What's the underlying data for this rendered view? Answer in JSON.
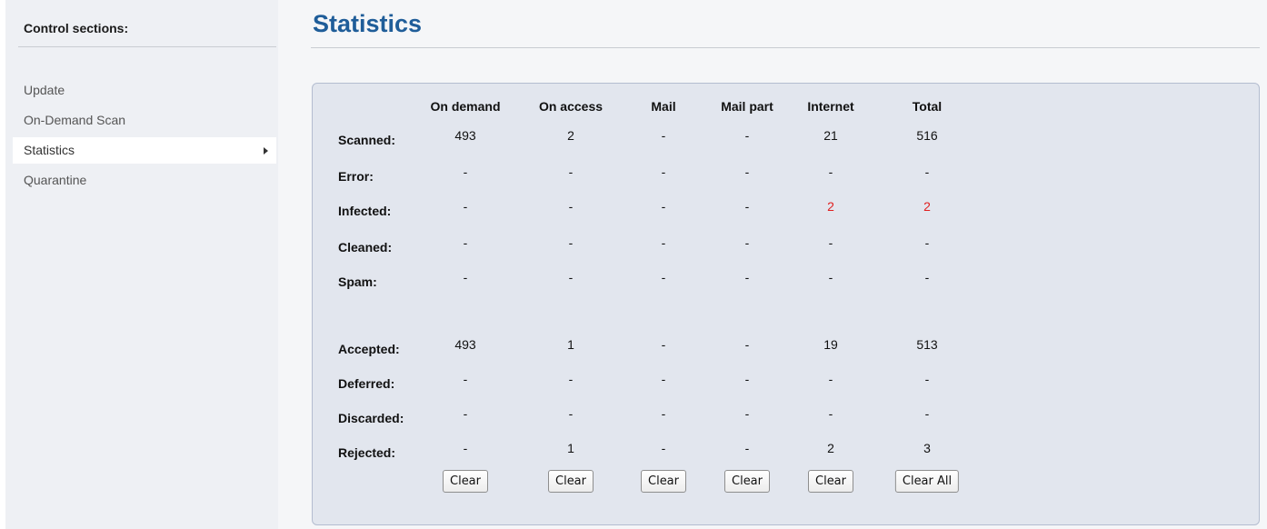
{
  "sidebar": {
    "title": "Control sections:",
    "items": [
      {
        "label": "Update"
      },
      {
        "label": "On-Demand Scan"
      },
      {
        "label": "Statistics",
        "active": true
      },
      {
        "label": "Quarantine"
      }
    ]
  },
  "main": {
    "title": "Statistics"
  },
  "stats": {
    "columns": [
      "On demand",
      "On access",
      "Mail",
      "Mail part",
      "Internet",
      "Total"
    ],
    "rows": [
      {
        "label": "Scanned:",
        "values": [
          "493",
          "2",
          "-",
          "-",
          "21",
          "516"
        ]
      },
      {
        "label": "Error:",
        "values": [
          "-",
          "-",
          "-",
          "-",
          "-",
          "-"
        ]
      },
      {
        "label": "Infected:",
        "values": [
          "-",
          "-",
          "-",
          "-",
          "2",
          "2"
        ]
      },
      {
        "label": "Cleaned:",
        "values": [
          "-",
          "-",
          "-",
          "-",
          "-",
          "-"
        ]
      },
      {
        "label": "Spam:",
        "values": [
          "-",
          "-",
          "-",
          "-",
          "-",
          "-"
        ]
      },
      {
        "label": "Accepted:",
        "values": [
          "493",
          "1",
          "-",
          "-",
          "19",
          "513"
        ]
      },
      {
        "label": "Deferred:",
        "values": [
          "-",
          "-",
          "-",
          "-",
          "-",
          "-"
        ]
      },
      {
        "label": "Discarded:",
        "values": [
          "-",
          "-",
          "-",
          "-",
          "-",
          "-"
        ]
      },
      {
        "label": "Rejected:",
        "values": [
          "-",
          "1",
          "-",
          "-",
          "2",
          "3"
        ]
      }
    ],
    "highlight_color": "#e02020",
    "buttons": [
      "Clear",
      "Clear",
      "Clear",
      "Clear",
      "Clear",
      "Clear All"
    ]
  }
}
